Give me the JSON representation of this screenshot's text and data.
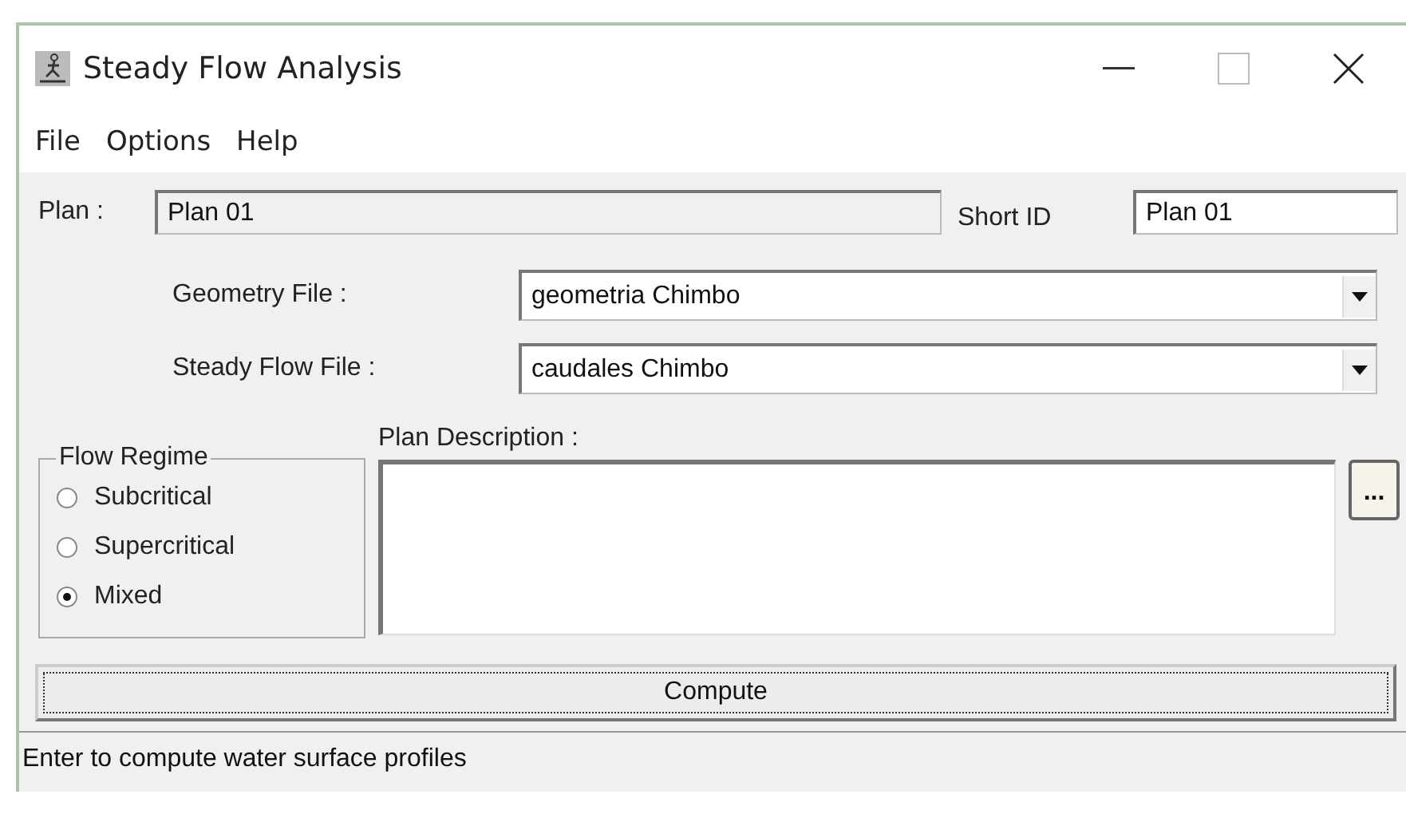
{
  "window": {
    "title": "Steady Flow Analysis"
  },
  "menu": [
    "File",
    "Options",
    "Help"
  ],
  "plan": {
    "label": "Plan :",
    "value": "Plan 01",
    "short_id_label": "Short ID",
    "short_id": "Plan 01"
  },
  "files": [
    {
      "label": "Geometry File :",
      "value": "geometria Chimbo"
    },
    {
      "label": "Steady Flow File :",
      "value": "caudales Chimbo"
    }
  ],
  "flow_regime": {
    "title": "Flow Regime",
    "options": [
      {
        "label": "Subcritical",
        "selected": false
      },
      {
        "label": "Supercritical",
        "selected": false
      },
      {
        "label": "Mixed",
        "selected": true
      }
    ]
  },
  "plan_description": {
    "label": "Plan Description :",
    "browse_button": "..."
  },
  "compute_button": "Compute",
  "status_bar": "Enter to compute water surface profiles"
}
